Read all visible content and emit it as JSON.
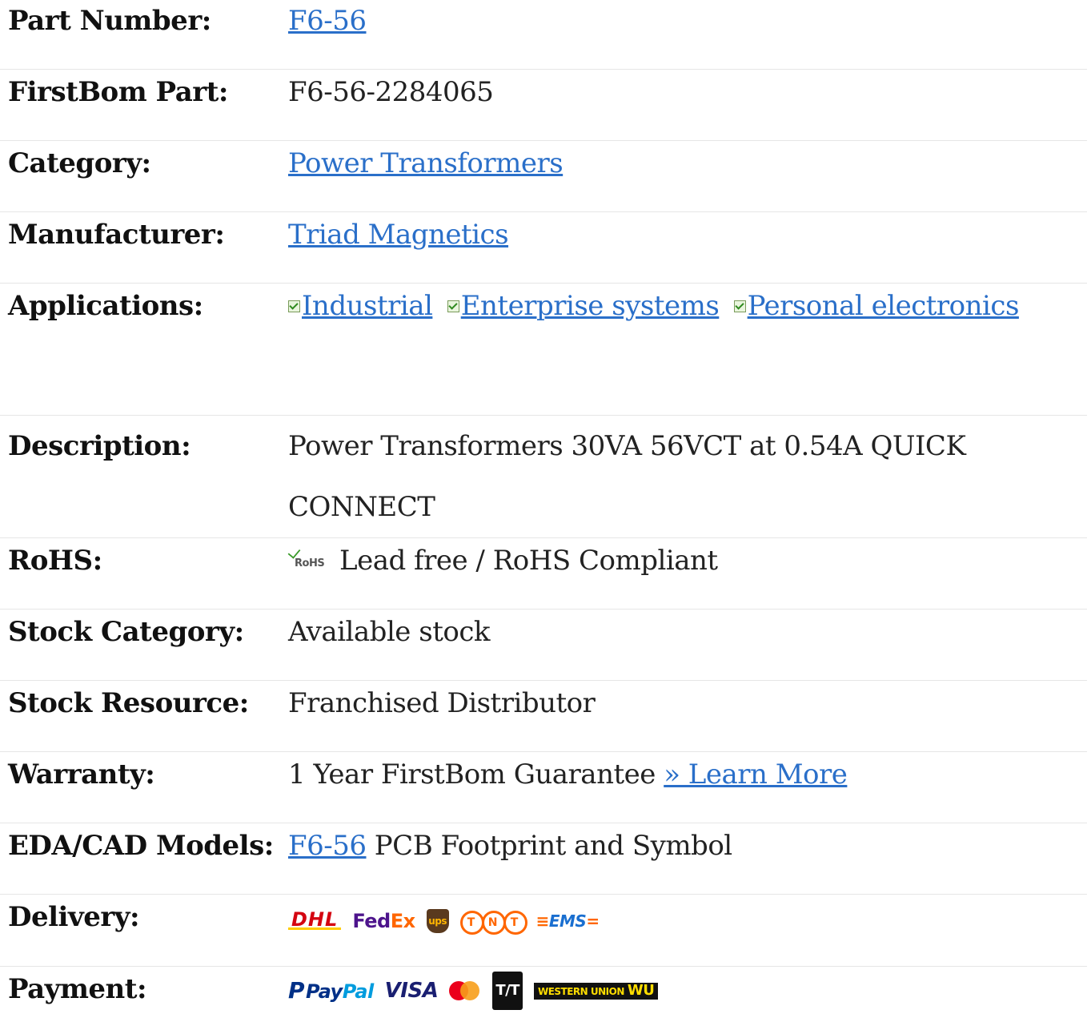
{
  "rows": {
    "part_number": {
      "label": "Part Number:",
      "value": "F6-56"
    },
    "firstbom_part": {
      "label": "FirstBom Part:",
      "value": "F6-56-2284065"
    },
    "category": {
      "label": "Category:",
      "value": "Power Transformers"
    },
    "manufacturer": {
      "label": "Manufacturer:",
      "value": "Triad Magnetics"
    },
    "applications": {
      "label": "Applications:",
      "items": [
        "Industrial",
        "Enterprise systems",
        "Personal electronics"
      ]
    },
    "description": {
      "label": "Description:",
      "value": "Power Transformers 30VA 56VCT at 0.54A QUICK CONNECT"
    },
    "rohs": {
      "label": "RoHS:",
      "logo_text": "RoHS",
      "value": "Lead free / RoHS Compliant"
    },
    "stock_category": {
      "label": "Stock Category:",
      "value": "Available stock"
    },
    "stock_resource": {
      "label": "Stock Resource:",
      "value": "Franchised Distributor"
    },
    "warranty": {
      "label": "Warranty:",
      "value": "1 Year FirstBom Guarantee",
      "link": "» Learn More"
    },
    "eda_cad": {
      "label": "EDA/CAD Models:",
      "link": "F6-56",
      "value": "PCB Footprint and Symbol"
    },
    "delivery": {
      "label": "Delivery:",
      "logos": {
        "dhl": "DHL",
        "fedex_fed": "Fed",
        "fedex_ex": "Ex",
        "ups": "ups",
        "tnt": [
          "T",
          "N",
          "T"
        ],
        "ems": "EMS"
      }
    },
    "payment": {
      "label": "Payment:",
      "logos": {
        "paypal_icon": "P",
        "paypal_pay": "Pay",
        "paypal_pal": "Pal",
        "visa": "VISA",
        "tt": "T/T",
        "wu_small": "WESTERN UNION",
        "wu_big": "WU"
      }
    }
  },
  "colors": {
    "link": "#2a6fc9",
    "text": "#222222",
    "divider": "#e6e6e6"
  }
}
